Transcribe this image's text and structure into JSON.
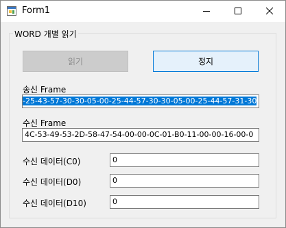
{
  "window": {
    "title": "Form1"
  },
  "group": {
    "label": "WORD 개별 읽기"
  },
  "buttons": {
    "read_label": "읽기",
    "stop_label": "정지"
  },
  "send_frame": {
    "label": "송신 Frame",
    "value": "-25-43-57-30-30-05-00-25-44-57-30-30-05-00-25-44-57-31-30"
  },
  "recv_frame": {
    "label": "수신 Frame",
    "value": "4C-53-49-53-2D-58-47-54-00-00-0C-01-B0-11-00-00-16-00-0"
  },
  "data_rows": [
    {
      "label": "수신 데이터(C0)",
      "value": "0"
    },
    {
      "label": "수신 데이터(D0)",
      "value": "0"
    },
    {
      "label": "수신 데이터(D10)",
      "value": "0"
    }
  ]
}
